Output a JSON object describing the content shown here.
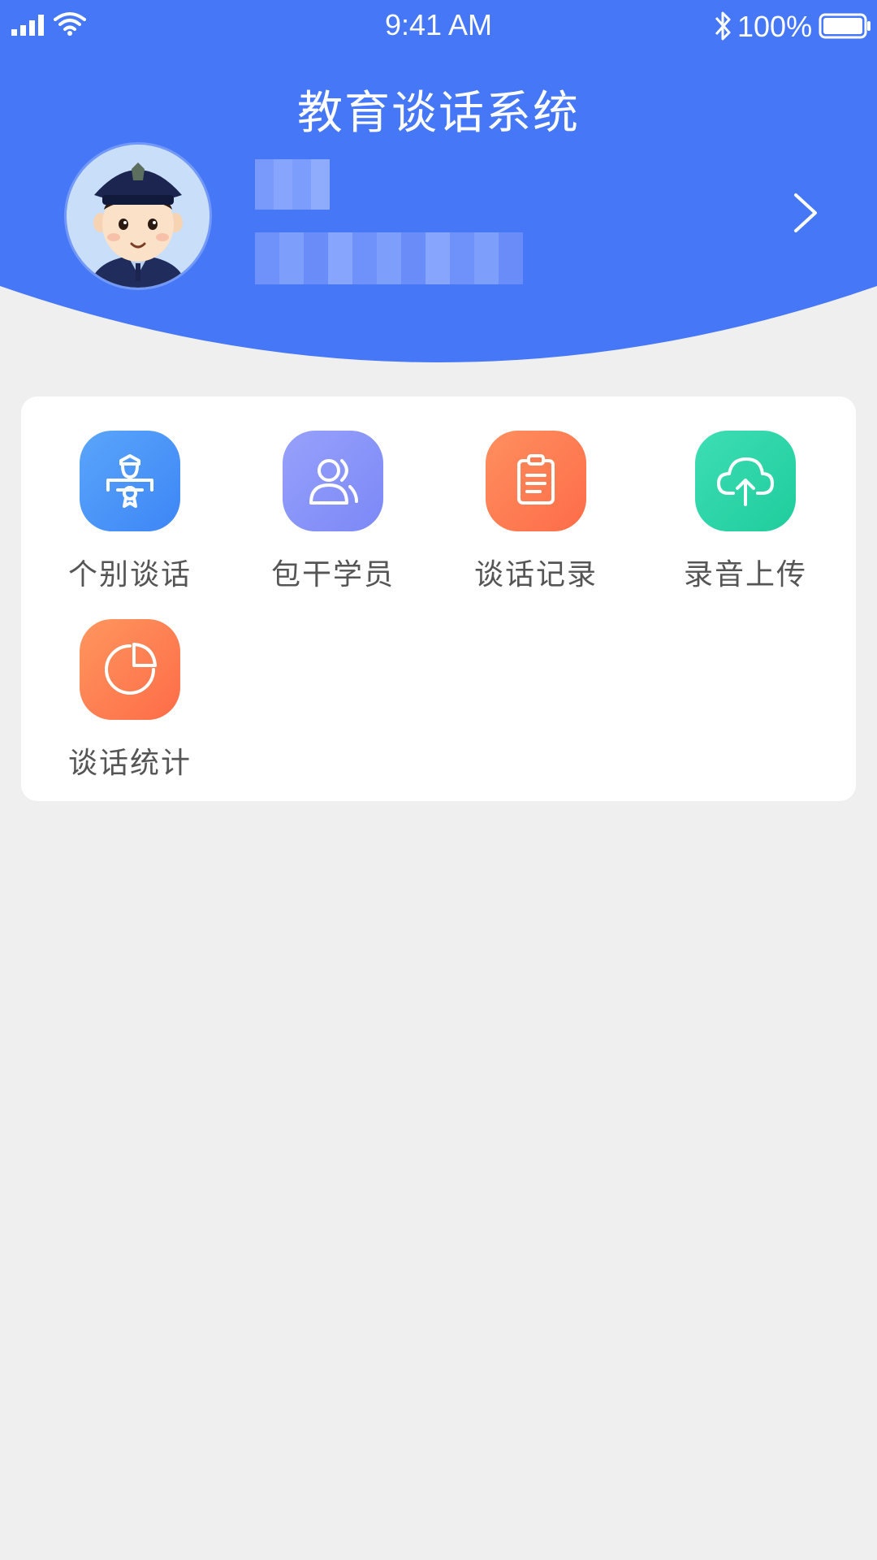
{
  "status_bar": {
    "time": "9:41 AM",
    "battery_percent": "100%"
  },
  "header": {
    "title": "教育谈话系统",
    "color": "#4577f6",
    "profile": {
      "name": "",
      "subtitle": ""
    }
  },
  "menu": {
    "items": [
      {
        "label": "个别谈话",
        "icon": "person-badge-icon",
        "gradient": [
          "#5aa5fb",
          "#3d86f6"
        ]
      },
      {
        "label": "包干学员",
        "icon": "users-icon",
        "gradient": [
          "#97a1fb",
          "#7c88f7"
        ]
      },
      {
        "label": "谈话记录",
        "icon": "clipboard-icon",
        "gradient": [
          "#ff8f5f",
          "#fd6c48"
        ]
      },
      {
        "label": "录音上传",
        "icon": "cloud-upload-icon",
        "gradient": [
          "#3ddeb4",
          "#1fcc9c"
        ]
      },
      {
        "label": "谈话统计",
        "icon": "pie-chart-icon",
        "gradient": [
          "#ff965e",
          "#fd6c48"
        ]
      }
    ]
  }
}
